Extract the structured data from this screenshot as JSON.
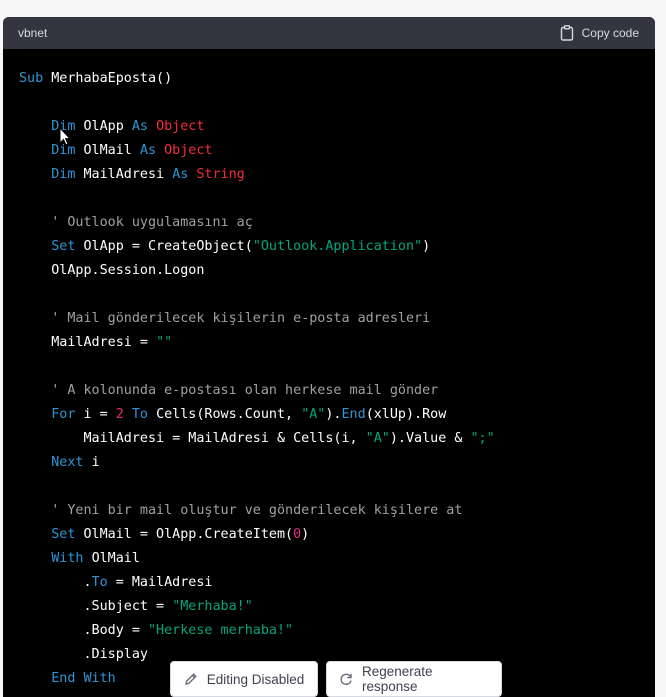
{
  "code_block": {
    "language": "vbnet",
    "copy_label": "Copy code",
    "copy_icon": "clipboard-icon",
    "lines": [
      [
        {
          "t": "Sub ",
          "c": "kw"
        },
        {
          "t": "MerhabaEposta()",
          "c": "pl"
        }
      ],
      [],
      [
        {
          "t": "    ",
          "c": "pl"
        },
        {
          "t": "Dim ",
          "c": "kw"
        },
        {
          "t": "OlApp ",
          "c": "pl"
        },
        {
          "t": "As ",
          "c": "kw"
        },
        {
          "t": "Object",
          "c": "ty"
        }
      ],
      [
        {
          "t": "    ",
          "c": "pl"
        },
        {
          "t": "Dim ",
          "c": "kw"
        },
        {
          "t": "OlMail ",
          "c": "pl"
        },
        {
          "t": "As ",
          "c": "kw"
        },
        {
          "t": "Object",
          "c": "ty"
        }
      ],
      [
        {
          "t": "    ",
          "c": "pl"
        },
        {
          "t": "Dim ",
          "c": "kw"
        },
        {
          "t": "MailAdresi ",
          "c": "pl"
        },
        {
          "t": "As ",
          "c": "kw"
        },
        {
          "t": "String",
          "c": "ty"
        }
      ],
      [],
      [
        {
          "t": "    ' Outlook uygulamasını aç",
          "c": "cm"
        }
      ],
      [
        {
          "t": "    ",
          "c": "pl"
        },
        {
          "t": "Set ",
          "c": "kw"
        },
        {
          "t": "OlApp = CreateObject(",
          "c": "pl"
        },
        {
          "t": "\"Outlook.Application\"",
          "c": "st"
        },
        {
          "t": ")",
          "c": "pl"
        }
      ],
      [
        {
          "t": "    OlApp.Session.Logon",
          "c": "pl"
        }
      ],
      [],
      [
        {
          "t": "    ' Mail gönderilecek kişilerin e-posta adresleri",
          "c": "cm"
        }
      ],
      [
        {
          "t": "    MailAdresi = ",
          "c": "pl"
        },
        {
          "t": "\"\"",
          "c": "st"
        }
      ],
      [],
      [
        {
          "t": "    ' A kolonunda e-postası olan herkese mail gönder",
          "c": "cm"
        }
      ],
      [
        {
          "t": "    ",
          "c": "pl"
        },
        {
          "t": "For ",
          "c": "kw"
        },
        {
          "t": "i = ",
          "c": "pl"
        },
        {
          "t": "2 ",
          "c": "nu"
        },
        {
          "t": "To ",
          "c": "kw"
        },
        {
          "t": "Cells(Rows.Count, ",
          "c": "pl"
        },
        {
          "t": "\"A\"",
          "c": "st"
        },
        {
          "t": ").",
          "c": "pl"
        },
        {
          "t": "End",
          "c": "kw"
        },
        {
          "t": "(xlUp).Row",
          "c": "pl"
        }
      ],
      [
        {
          "t": "        MailAdresi = MailAdresi & Cells(i, ",
          "c": "pl"
        },
        {
          "t": "\"A\"",
          "c": "st"
        },
        {
          "t": ").Value & ",
          "c": "pl"
        },
        {
          "t": "\";\"",
          "c": "st"
        }
      ],
      [
        {
          "t": "    ",
          "c": "pl"
        },
        {
          "t": "Next ",
          "c": "kw"
        },
        {
          "t": "i",
          "c": "pl"
        }
      ],
      [],
      [
        {
          "t": "    ' Yeni bir mail oluştur ve gönderilecek kişilere at",
          "c": "cm"
        }
      ],
      [
        {
          "t": "    ",
          "c": "pl"
        },
        {
          "t": "Set ",
          "c": "kw"
        },
        {
          "t": "OlMail = OlApp.CreateItem(",
          "c": "pl"
        },
        {
          "t": "0",
          "c": "nu"
        },
        {
          "t": ")",
          "c": "pl"
        }
      ],
      [
        {
          "t": "    ",
          "c": "pl"
        },
        {
          "t": "With ",
          "c": "kw"
        },
        {
          "t": "OlMail",
          "c": "pl"
        }
      ],
      [
        {
          "t": "        .",
          "c": "pl"
        },
        {
          "t": "To",
          "c": "kw"
        },
        {
          "t": " = MailAdresi",
          "c": "pl"
        }
      ],
      [
        {
          "t": "        .Subject = ",
          "c": "pl"
        },
        {
          "t": "\"Merhaba!\"",
          "c": "st"
        }
      ],
      [
        {
          "t": "        .Body = ",
          "c": "pl"
        },
        {
          "t": "\"Herkese merhaba!\"",
          "c": "st"
        }
      ],
      [
        {
          "t": "        .Display",
          "c": "pl"
        }
      ],
      [
        {
          "t": "    ",
          "c": "pl"
        },
        {
          "t": "End With",
          "c": "kw"
        }
      ]
    ]
  },
  "actions": {
    "editing_label": "Editing Disabled",
    "editing_icon": "pencil-icon",
    "regenerate_label": "Regenerate response",
    "regenerate_icon": "refresh-icon"
  },
  "colors": {
    "page_background": "#f7f7f8",
    "header_background": "#343541",
    "code_background": "#000000",
    "keyword": "#2e95d3",
    "type": "#f22c3d",
    "string": "#00a67d",
    "number": "#df3079",
    "comment": "#a0a0a0"
  }
}
